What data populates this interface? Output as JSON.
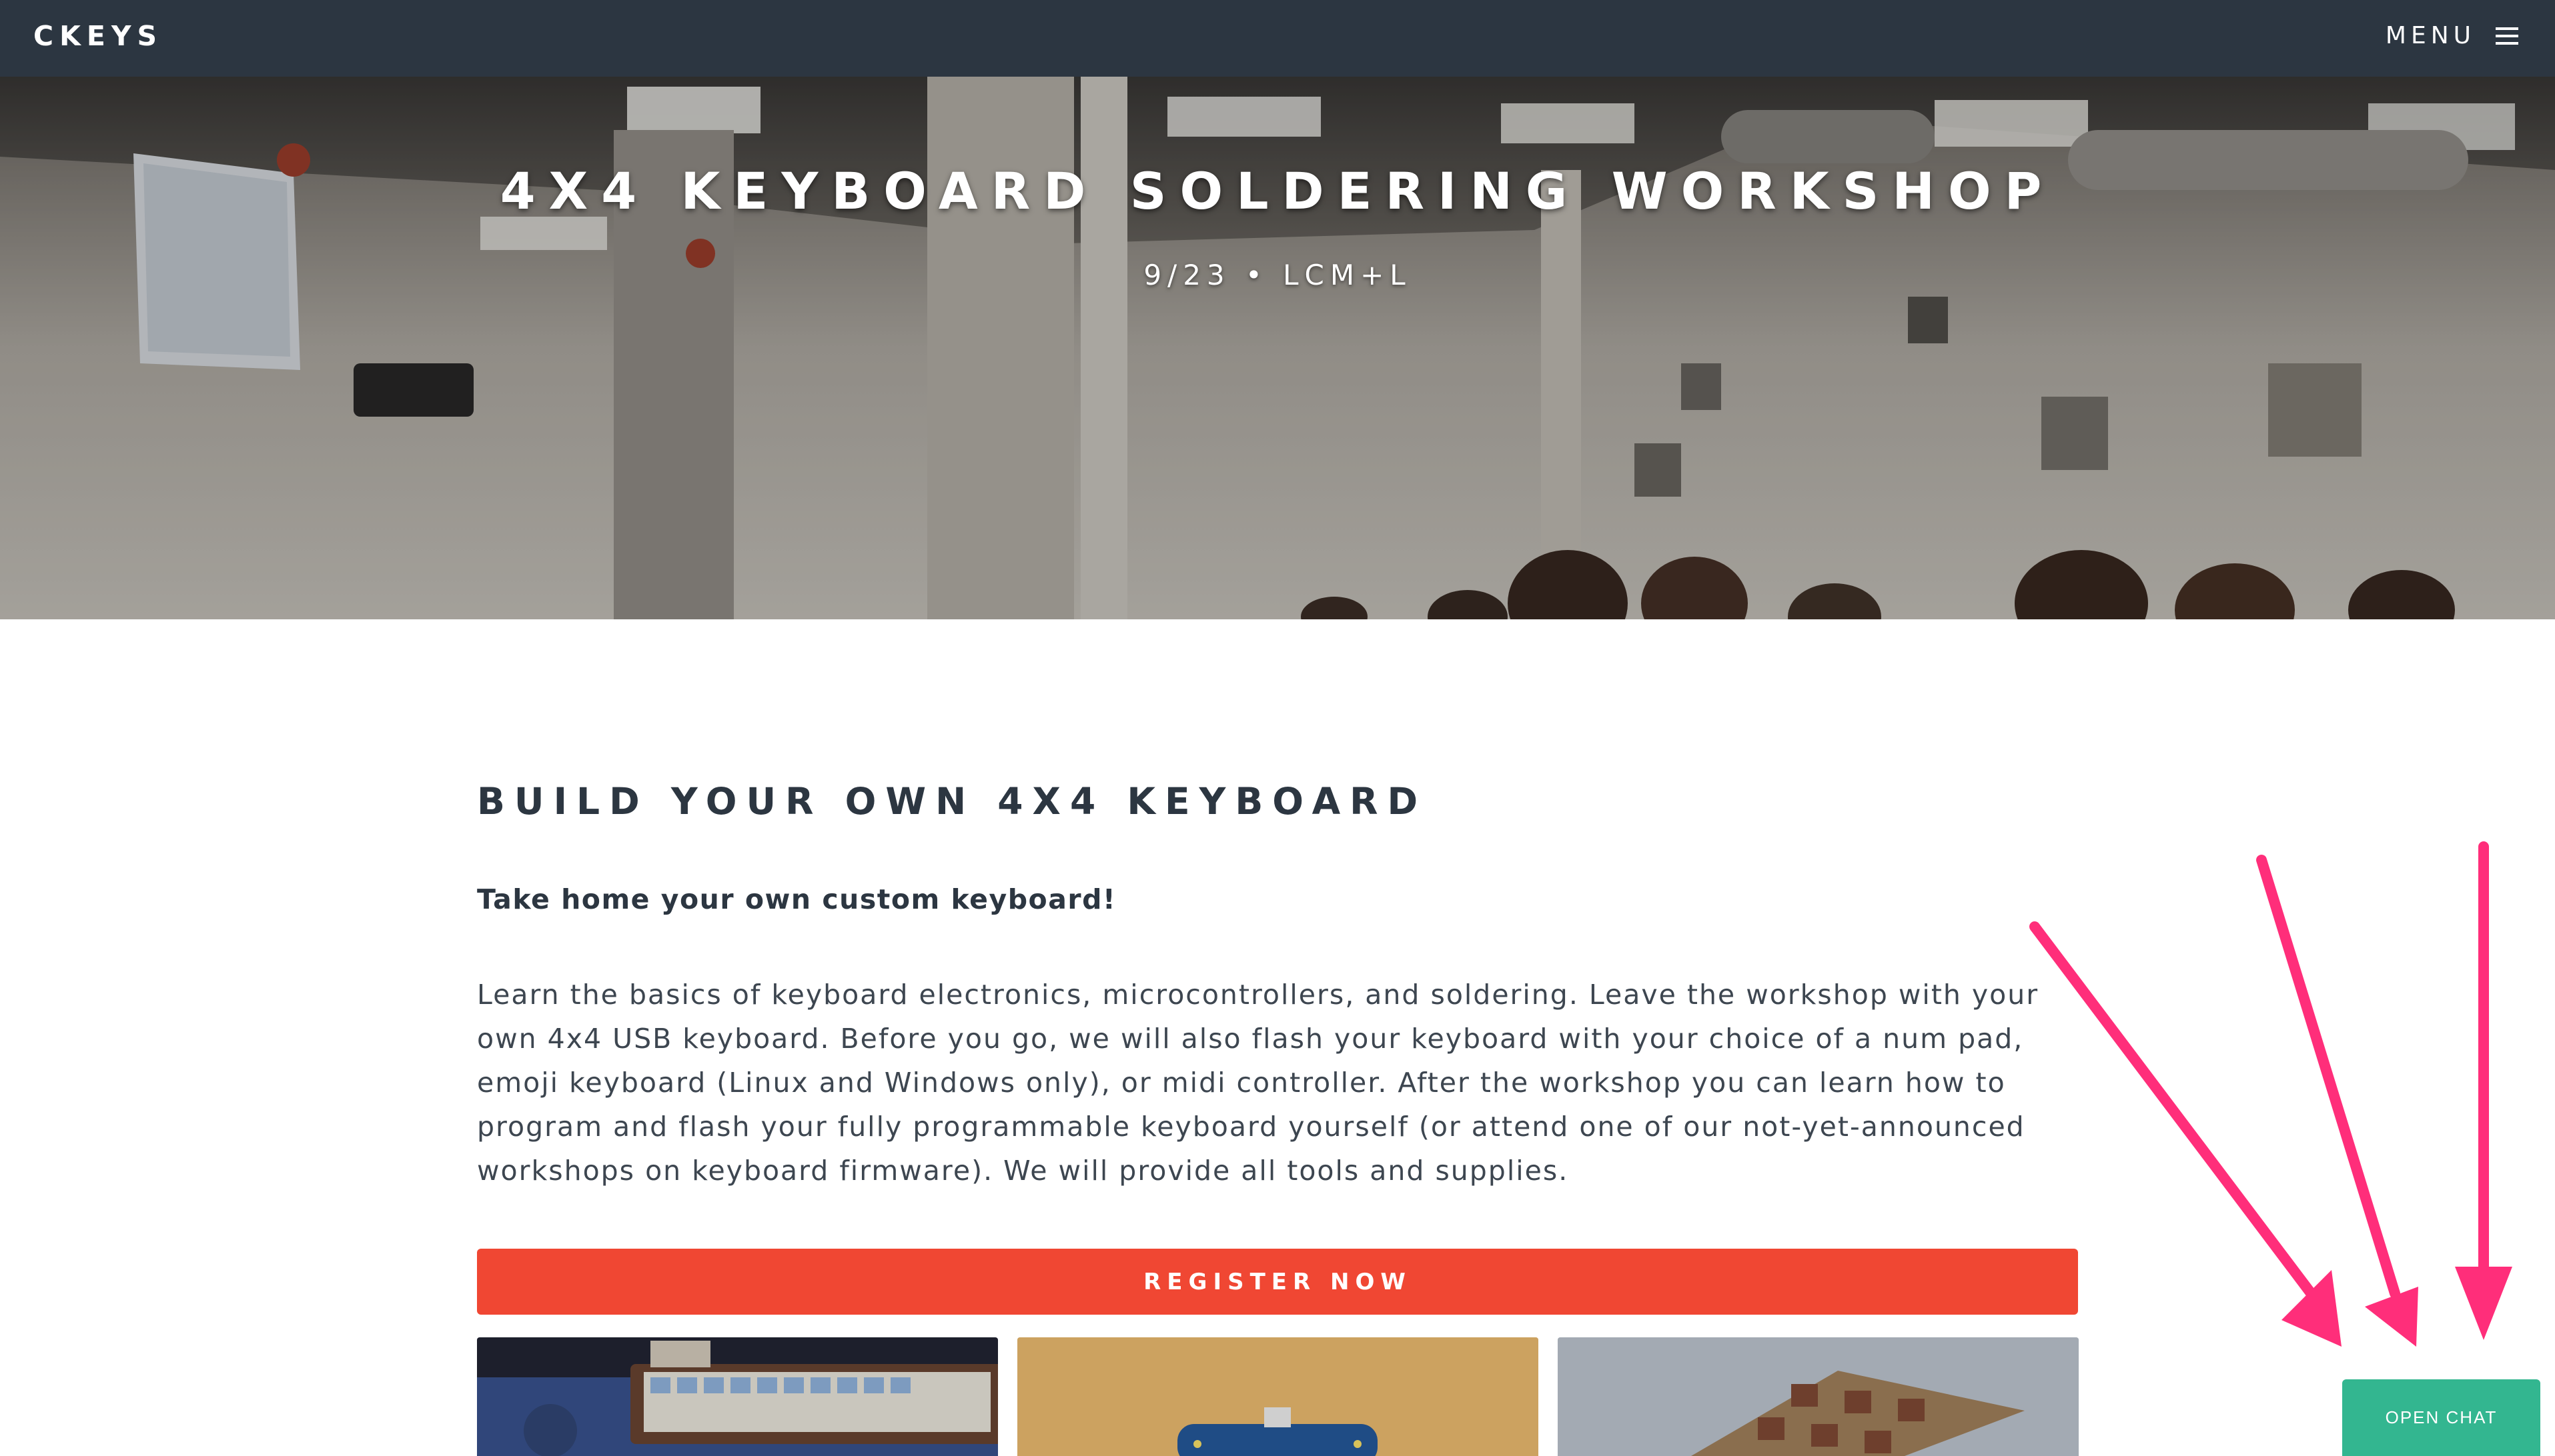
{
  "nav": {
    "brand": "CKEYS",
    "menu_label": "MENU"
  },
  "hero": {
    "title": "4X4 KEYBOARD SOLDERING WORKSHOP",
    "subtitle": "9/23 • LCM+L"
  },
  "main": {
    "section_title": "BUILD YOUR OWN 4X4 KEYBOARD",
    "tagline": "Take home your own custom keyboard!",
    "description": "Learn the basics of keyboard electronics, microcontrollers, and soldering. Leave the workshop with your own 4x4 USB keyboard. Before you go, we will also flash your keyboard with your choice of a num pad, emoji keyboard (Linux and Windows only), or midi controller. After the workshop you can learn how to program and flash your fully programmable keyboard yourself (or attend one of our not-yet-announced workshops on keyboard firmware). We will provide all tools and supplies.",
    "register_label": "REGISTER NOW"
  },
  "chat": {
    "button_label": "OPEN CHAT"
  },
  "colors": {
    "nav_bg": "#2c3641",
    "accent_red": "#f04733",
    "chat_green": "#33b690",
    "annotation_pink": "#ff2e7a"
  },
  "icons": [
    "hamburger-menu-icon",
    "annotation-arrow"
  ]
}
